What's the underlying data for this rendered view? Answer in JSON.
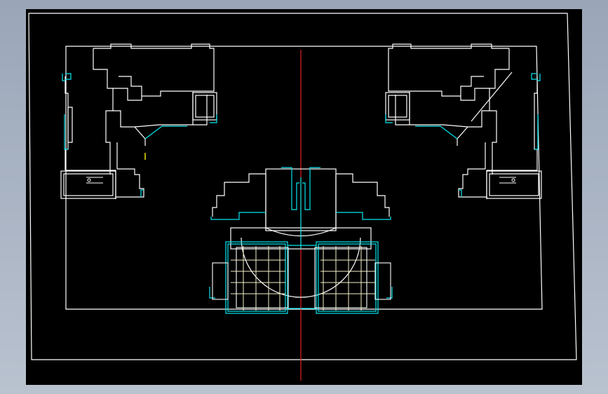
{
  "drawing": {
    "background": "#000000",
    "frame_background": "#aab4c3",
    "colors": {
      "outline": "#ffffff",
      "highlight": "#00e5ee",
      "centerline": "#e02020",
      "grid": "#f5f0c8",
      "marker": "#e8e000"
    },
    "labels": []
  }
}
